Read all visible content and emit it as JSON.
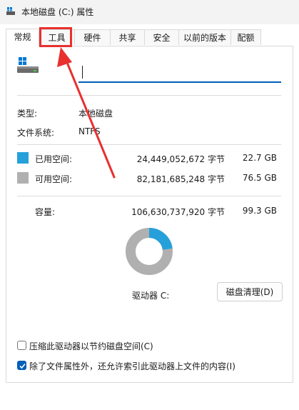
{
  "window": {
    "title": "本地磁盘 (C:) 属性",
    "icon": "drive-icon"
  },
  "tabs": [
    {
      "label": "常规",
      "active": true
    },
    {
      "label": "工具",
      "active": false
    },
    {
      "label": "硬件",
      "active": false
    },
    {
      "label": "共享",
      "active": false
    },
    {
      "label": "安全",
      "active": false
    },
    {
      "label": "以前的版本",
      "active": false
    },
    {
      "label": "配额",
      "active": false
    }
  ],
  "general": {
    "name_value": "",
    "type_label": "类型:",
    "type_value": "本地磁盘",
    "fs_label": "文件系统:",
    "fs_value": "NTFS",
    "used": {
      "label": "已用空间:",
      "bytes": "24,449,052,672 字节",
      "size": "22.7 GB",
      "color": "#26a0da"
    },
    "free": {
      "label": "可用空间:",
      "bytes": "82,181,685,248 字节",
      "size": "76.5 GB",
      "color": "#b0b0b0"
    },
    "capacity": {
      "label": "容量:",
      "bytes": "106,630,737,920 字节",
      "size": "99.3 GB"
    },
    "used_fraction": 0.229,
    "drive_label": "驱动器 C:",
    "cleanup_button": "磁盘清理(D)",
    "compress_label": "压缩此驱动器以节约磁盘空间(C)",
    "compress_checked": false,
    "index_label": "除了文件属性外，还允许索引此驱动器上文件的内容(I)",
    "index_checked": true
  },
  "annotation": {
    "color": "#e8302f"
  }
}
